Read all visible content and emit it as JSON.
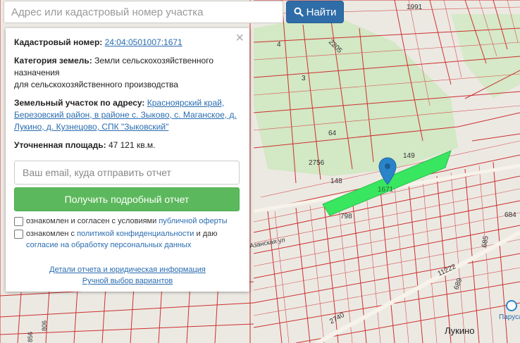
{
  "search": {
    "placeholder": "Адрес или кадастровый номер участка",
    "button_label": "Найти"
  },
  "panel": {
    "close_glyph": "×",
    "cadastral_label": "Кадастровый номер:",
    "cadastral_value": "24:04:0501007:1671",
    "category_label": "Категория земель:",
    "category_value_1": "Земли сельскохозяйственного назначения",
    "category_value_2": "для сельскохозяйственного производства",
    "address_label": "Земельный участок по адресу:",
    "address_value": "Красноярский край, Березовский район, в районе с. Зыково, с. Маганское, д. Лукино, д. Кузнецово, СПК \"Зыковский\"",
    "area_label": "Уточненная площадь:",
    "area_value": "47 121 кв.м.",
    "email_placeholder": "Ваш email, куда отправить отчет",
    "get_report_label": "Получить подробный отчет",
    "agree1_text": "ознакомлен и согласен с условиями",
    "agree1_link": "публичной оферты",
    "agree2_text": "ознакомлен с",
    "agree2_link": "политикой конфиденциальности",
    "agree2_and": "и даю",
    "agree2_link2": "согласие на обработку персональных данных",
    "details_link": "Детали отчета и юридическая информация",
    "manual_link": "Ручной выбор вариантов"
  },
  "map": {
    "labels": [
      "1991",
      "2205",
      "4",
      "3",
      "64",
      "2756",
      "148",
      "149",
      "1671",
      "798",
      "684",
      "689",
      "11222",
      "685",
      "2740",
      "Лукино",
      "Паруса",
      "Азанская ул",
      "806",
      "856"
    ],
    "parcel_color": "#39e65f",
    "line_color": "#cc2b2b",
    "green_color": "#d2e8c2"
  }
}
